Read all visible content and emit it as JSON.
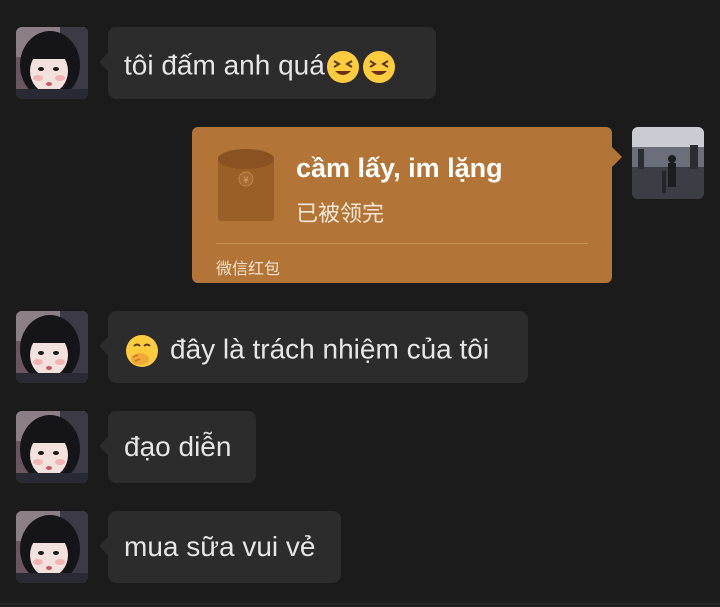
{
  "messages": [
    {
      "side": "left",
      "text": "tôi đấm anh quá",
      "emoji_after": [
        "grinning-squinting-face-icon",
        "grinning-squinting-face-icon"
      ]
    },
    {
      "side": "right",
      "type": "red-packet",
      "title": "cầm lấy, im lặng",
      "status": "已被领完",
      "footer": "微信红包"
    },
    {
      "side": "left",
      "text": "đây là trách nhiệm của tôi",
      "emoji_before": "face-with-hand-over-mouth-icon"
    },
    {
      "side": "left",
      "text": "đạo diễn"
    },
    {
      "side": "left",
      "text": "mua sữa vui vẻ"
    }
  ],
  "colors": {
    "background": "#1b1b1b",
    "bubble": "#2c2c2c",
    "red_packet": "#b27537",
    "text": "#e6e6e6"
  }
}
